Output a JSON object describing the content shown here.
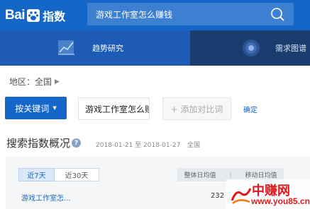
{
  "header": {
    "logo": {
      "bai": "Bai",
      "du": "du",
      "zhishu": "指数"
    },
    "search": {
      "value": "游戏工作室怎么赚钱",
      "icon": "search-icon"
    }
  },
  "nav": {
    "items": [
      {
        "label": "趋势研究",
        "icon": "trend-chart-icon",
        "active": true
      },
      {
        "label": "需求图谱",
        "icon": "demand-graph-icon",
        "active": false
      }
    ]
  },
  "region": {
    "label": "地区：全国"
  },
  "keyword_bar": {
    "mode_label": "按关键词",
    "keyword": "游戏工作室怎么赚钱",
    "add_compare": "+ 添加对比词",
    "confirm": "确定"
  },
  "overview": {
    "title": "搜索指数概况",
    "date_range": "2018-01-21 至 2018-01-27",
    "region": "全国",
    "tabs": [
      {
        "label": "近7天",
        "active": true
      },
      {
        "label": "近30天",
        "active": false
      }
    ],
    "columns": [
      "整体日均值",
      "移动日均值"
    ],
    "rows": [
      {
        "keyword": "游戏工作室怎...",
        "overall_avg": "232"
      }
    ]
  },
  "watermark": {
    "title": "中赚网",
    "url": "www.you85.cn"
  },
  "colors": {
    "brand_blue": "#1466c7",
    "nav_dark": "#1a3c6e",
    "watermark_red": "#e0181b"
  }
}
